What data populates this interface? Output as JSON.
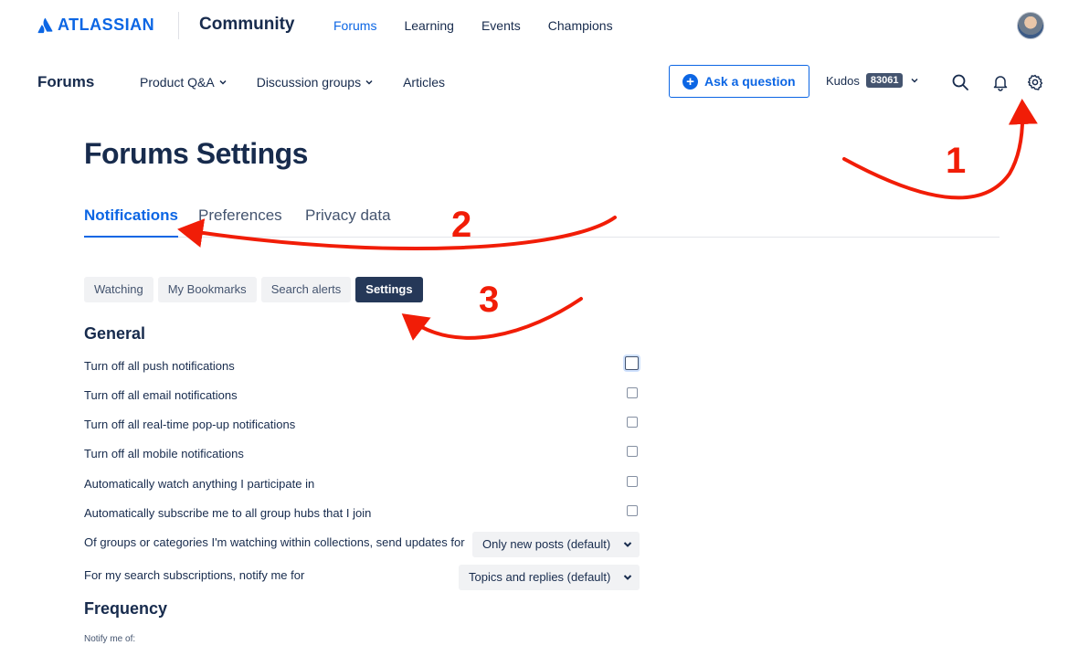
{
  "global_header": {
    "brand": "ATLASSIAN",
    "product": "Community",
    "nav": [
      "Forums",
      "Learning",
      "Events",
      "Champions"
    ],
    "active_nav": "Forums"
  },
  "sub_header": {
    "title": "Forums",
    "nav": [
      {
        "label": "Product Q&A",
        "has_dropdown": true
      },
      {
        "label": "Discussion groups",
        "has_dropdown": true
      },
      {
        "label": "Articles",
        "has_dropdown": false
      }
    ],
    "ask_button": "Ask a question",
    "kudos_label": "Kudos",
    "kudos_count": "83061"
  },
  "page": {
    "title": "Forums Settings",
    "tabs": [
      "Notifications",
      "Preferences",
      "Privacy data"
    ],
    "active_tab": "Notifications",
    "subtabs": [
      "Watching",
      "My Bookmarks",
      "Search alerts",
      "Settings"
    ],
    "active_subtab": "Settings"
  },
  "general": {
    "heading": "General",
    "checkboxes": [
      {
        "label": "Turn off all push notifications",
        "checked": false
      },
      {
        "label": "Turn off all email notifications",
        "checked": false
      },
      {
        "label": "Turn off all real-time pop-up notifications",
        "checked": false
      },
      {
        "label": "Turn off all mobile notifications",
        "checked": false
      },
      {
        "label": "Automatically watch anything I participate in",
        "checked": false
      },
      {
        "label": "Automatically subscribe me to all group hubs that I join",
        "checked": false
      }
    ],
    "selects": [
      {
        "label": "Of groups or categories I'm watching within collections, send updates for",
        "value": "Only new posts (default)"
      },
      {
        "label": "For my search subscriptions, notify me for",
        "value": "Topics and replies (default)"
      }
    ]
  },
  "frequency": {
    "heading": "Frequency",
    "notify_label": "Notify me of:"
  },
  "annotations": {
    "labels": [
      "1",
      "2",
      "3"
    ],
    "color": "#f11d07"
  },
  "colors": {
    "accent": "#0c66e4",
    "text": "#172b4d",
    "active_pill": "#253858"
  }
}
